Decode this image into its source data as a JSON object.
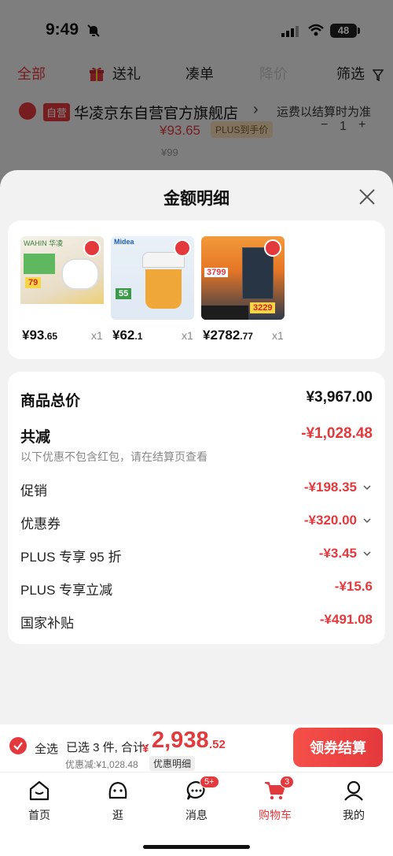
{
  "status_bar": {
    "time": "9:49",
    "battery": "48"
  },
  "filter_tabs": [
    {
      "label": "全部"
    },
    {
      "label": "送礼"
    },
    {
      "label": "凑单"
    },
    {
      "label": "降价"
    },
    {
      "label": "筛选"
    }
  ],
  "store": {
    "badge": "自营",
    "name": "华凌京东自营官方旗舰店",
    "arrow": "›",
    "shipping_note": "运费以结算时为准",
    "bg_price": "¥93.65",
    "bg_plus_tag": "PLUS到手价",
    "bg_original_price": "¥99",
    "bg_qty": "1"
  },
  "sheet": {
    "title": "金额明细",
    "products": [
      {
        "price_int": "¥93",
        "price_dec": ".65",
        "qty": "x1",
        "img_badge": "79",
        "img_tag": "WAHIN 华凌"
      },
      {
        "price_int": "¥62",
        "price_dec": ".1",
        "qty": "x1",
        "img_badge": "55",
        "img_tag": "Midea"
      },
      {
        "price_int": "¥2782",
        "price_dec": ".77",
        "qty": "x1",
        "img_badge": "3229",
        "img_tag": "3799"
      }
    ],
    "summary": {
      "total_label": "商品总价",
      "total_value": "¥3,967.00",
      "reduce_label": "共减",
      "reduce_value": "-¥1,028.48",
      "reduce_note": "以下优惠不包含红包，请在结算页查看",
      "items": [
        {
          "label": "促销",
          "value": "-¥198.35",
          "expandable": true
        },
        {
          "label": "优惠券",
          "value": "-¥320.00",
          "expandable": true
        },
        {
          "label": "PLUS 专享 95 折",
          "value": "-¥3.45",
          "expandable": true
        },
        {
          "label": "PLUS 专享立减",
          "value": "-¥15.6",
          "expandable": false
        },
        {
          "label": "国家补贴",
          "value": "-¥491.08",
          "expandable": false
        }
      ]
    }
  },
  "checkout": {
    "select_all": "全选",
    "selected_text": "已选 3 件, 合计:",
    "currency": "¥",
    "total_int": "2,938",
    "total_dec": ".52",
    "discount_note": "优惠减:¥1,028.48",
    "detail_chip": "优惠明细",
    "button": "领券结算"
  },
  "tabbar": [
    {
      "label": "首页",
      "icon": "home-icon"
    },
    {
      "label": "逛",
      "icon": "browse-icon"
    },
    {
      "label": "消息",
      "icon": "message-icon",
      "badge": "5+"
    },
    {
      "label": "购物车",
      "icon": "cart-icon",
      "badge": "3",
      "active": true
    },
    {
      "label": "我的",
      "icon": "profile-icon"
    }
  ],
  "colors": {
    "accent": "#e4393c",
    "background": "#f2f2f2"
  }
}
